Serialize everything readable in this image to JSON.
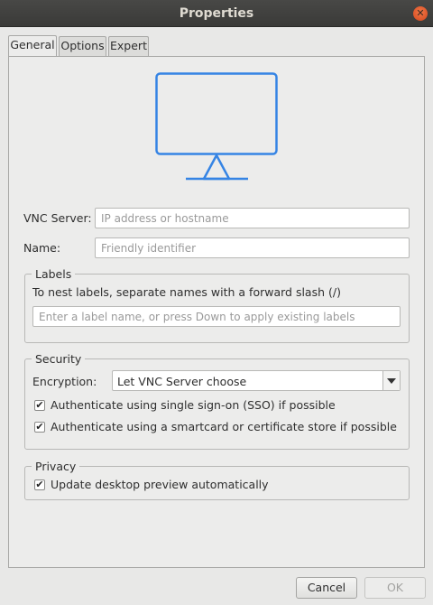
{
  "window": {
    "title": "Properties"
  },
  "tabs": [
    {
      "label": "General",
      "active": true
    },
    {
      "label": "Options",
      "active": false
    },
    {
      "label": "Expert",
      "active": false
    }
  ],
  "general": {
    "vnc_server": {
      "label": "VNC Server:",
      "value": "",
      "placeholder": "IP address or hostname"
    },
    "name": {
      "label": "Name:",
      "value": "",
      "placeholder": "Friendly identifier"
    },
    "labels": {
      "title": "Labels",
      "hint": "To nest labels, separate names with a forward slash (/)",
      "placeholder": "Enter a label name, or press Down to apply existing labels"
    },
    "security": {
      "title": "Security",
      "encryption_label": "Encryption:",
      "encryption_value": "Let VNC Server choose",
      "sso": {
        "label": "Authenticate using single sign-on (SSO) if possible",
        "checked": true
      },
      "smartcard": {
        "label": "Authenticate using a smartcard or certificate store if possible",
        "checked": true
      }
    },
    "privacy": {
      "title": "Privacy",
      "preview": {
        "label": "Update desktop preview automatically",
        "checked": true
      }
    }
  },
  "footer": {
    "cancel_label": "Cancel",
    "ok_label": "OK"
  },
  "colors": {
    "accent": "#3584e4",
    "titlebar": "#3c3c3a",
    "close": "#e95420"
  },
  "icons": {
    "close": "close-icon",
    "monitor": "monitor-icon",
    "dropdown": "chevron-down-icon",
    "check": "checkmark-icon"
  }
}
